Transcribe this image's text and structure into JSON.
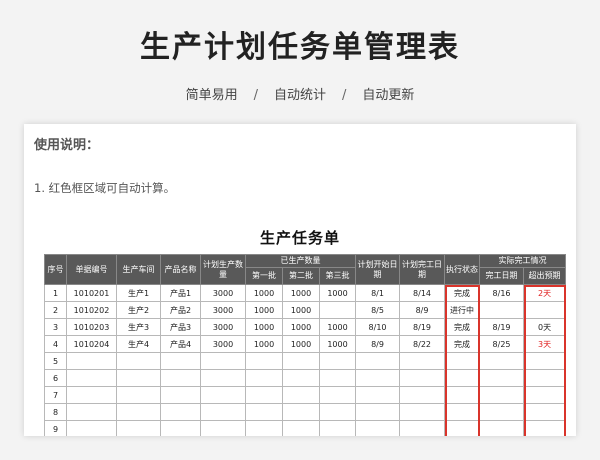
{
  "page": {
    "title": "生产计划任务单管理表",
    "features": [
      "简单易用",
      "自动统计",
      "自动更新"
    ],
    "separator": "/"
  },
  "sheet": {
    "usage_heading": "使用说明：",
    "usage_items": [
      "1. 红色框区域可自动计算。"
    ],
    "table_title": "生产任务单",
    "headers": {
      "seq": "序号",
      "order_no": "单据编号",
      "workshop": "生产车间",
      "product": "产品名称",
      "planned_qty": "计划生产数量",
      "produced_group": "已生产数量",
      "batch1": "第一批",
      "batch2": "第二批",
      "batch3": "第三批",
      "plan_start": "计划开始日期",
      "plan_finish": "计划完工日期",
      "status": "执行状态",
      "actual_group": "实际完工情况",
      "actual_finish": "完工日期",
      "overdue": "超出预期"
    },
    "rows": [
      {
        "seq": "1",
        "order_no": "1010201",
        "workshop": "生产1",
        "product": "产品1",
        "planned_qty": "3000",
        "batch1": "1000",
        "batch2": "1000",
        "batch3": "1000",
        "plan_start": "8/1",
        "plan_finish": "8/14",
        "status": "完成",
        "actual_finish": "8/16",
        "overdue": "2天",
        "overdue_color": "#e02020"
      },
      {
        "seq": "2",
        "order_no": "1010202",
        "workshop": "生产2",
        "product": "产品2",
        "planned_qty": "3000",
        "batch1": "1000",
        "batch2": "1000",
        "batch3": "",
        "plan_start": "8/5",
        "plan_finish": "8/9",
        "status": "进行中",
        "actual_finish": "",
        "overdue": "",
        "overdue_color": ""
      },
      {
        "seq": "3",
        "order_no": "1010203",
        "workshop": "生产3",
        "product": "产品3",
        "planned_qty": "3000",
        "batch1": "1000",
        "batch2": "1000",
        "batch3": "1000",
        "plan_start": "8/10",
        "plan_finish": "8/19",
        "status": "完成",
        "actual_finish": "8/19",
        "overdue": "0天",
        "overdue_color": "#222222"
      },
      {
        "seq": "4",
        "order_no": "1010204",
        "workshop": "生产4",
        "product": "产品4",
        "planned_qty": "3000",
        "batch1": "1000",
        "batch2": "1000",
        "batch3": "1000",
        "plan_start": "8/9",
        "plan_finish": "8/22",
        "status": "完成",
        "actual_finish": "8/25",
        "overdue": "3天",
        "overdue_color": "#e02020"
      },
      {
        "seq": "5",
        "order_no": "",
        "workshop": "",
        "product": "",
        "planned_qty": "",
        "batch1": "",
        "batch2": "",
        "batch3": "",
        "plan_start": "",
        "plan_finish": "",
        "status": "",
        "actual_finish": "",
        "overdue": "",
        "overdue_color": ""
      },
      {
        "seq": "6",
        "order_no": "",
        "workshop": "",
        "product": "",
        "planned_qty": "",
        "batch1": "",
        "batch2": "",
        "batch3": "",
        "plan_start": "",
        "plan_finish": "",
        "status": "",
        "actual_finish": "",
        "overdue": "",
        "overdue_color": ""
      },
      {
        "seq": "7",
        "order_no": "",
        "workshop": "",
        "product": "",
        "planned_qty": "",
        "batch1": "",
        "batch2": "",
        "batch3": "",
        "plan_start": "",
        "plan_finish": "",
        "status": "",
        "actual_finish": "",
        "overdue": "",
        "overdue_color": ""
      },
      {
        "seq": "8",
        "order_no": "",
        "workshop": "",
        "product": "",
        "planned_qty": "",
        "batch1": "",
        "batch2": "",
        "batch3": "",
        "plan_start": "",
        "plan_finish": "",
        "status": "",
        "actual_finish": "",
        "overdue": "",
        "overdue_color": ""
      },
      {
        "seq": "9",
        "order_no": "",
        "workshop": "",
        "product": "",
        "planned_qty": "",
        "batch1": "",
        "batch2": "",
        "batch3": "",
        "plan_start": "",
        "plan_finish": "",
        "status": "",
        "actual_finish": "",
        "overdue": "",
        "overdue_color": ""
      }
    ],
    "highlight_color": "#d9342b"
  }
}
